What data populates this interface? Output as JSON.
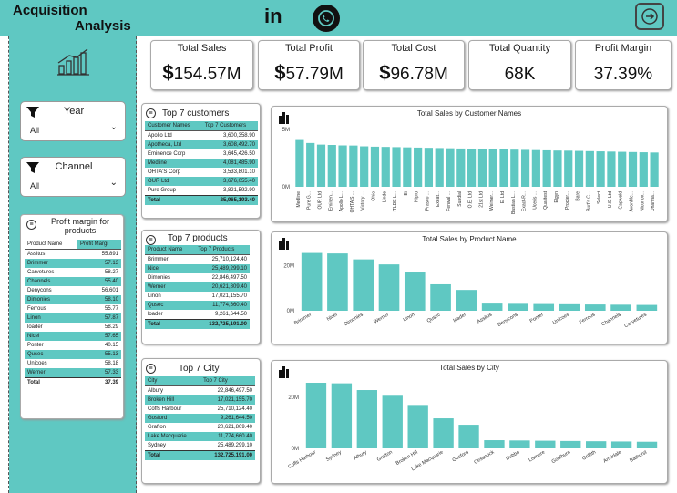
{
  "header": {
    "title_line1": "Acquisition",
    "title_line2": "Analysis",
    "linkedin": "in",
    "whatsapp_icon": "whatsapp-icon",
    "nav_icon": "arrow-right-icon"
  },
  "kpis": [
    {
      "label": "Total Sales",
      "currency": "$",
      "value": "154.57M"
    },
    {
      "label": "Total Profit",
      "currency": "$",
      "value": "57.79M"
    },
    {
      "label": "Total Cost",
      "currency": "$",
      "value": "96.78M"
    },
    {
      "label": "Total Quantity",
      "currency": "",
      "value": "68K"
    },
    {
      "label": "Profit Margin",
      "currency": "",
      "value": "37.39%"
    }
  ],
  "slicers": {
    "year": {
      "title": "Year",
      "value": "All"
    },
    "channel": {
      "title": "Channel",
      "value": "All"
    }
  },
  "profit_margin_table": {
    "title": "Profit margin for products",
    "col1": "Product Name",
    "col2": "Profit Margi",
    "rows": [
      [
        "Assitus",
        "55.891"
      ],
      [
        "Brimmer",
        "57.13"
      ],
      [
        "Carvetures",
        "58.27"
      ],
      [
        "Channels",
        "55.40"
      ],
      [
        "Denycons",
        "56.601"
      ],
      [
        "Dimonies",
        "58.10"
      ],
      [
        "Ferrous",
        "55.77"
      ],
      [
        "Linon",
        "57.87"
      ],
      [
        "loader",
        "58.29"
      ],
      [
        "Nicel",
        "57.65"
      ],
      [
        "Ponter",
        "40.15"
      ],
      [
        "Qusec",
        "55.13"
      ],
      [
        "Unicoes",
        "58.18"
      ],
      [
        "Werner",
        "57.33"
      ]
    ],
    "total": [
      "Total",
      "37.39"
    ]
  },
  "top_customers": {
    "title": "Top 7 customers",
    "col1": "Customer Names",
    "col2": "Top 7 Customers",
    "rows": [
      [
        "Apollo Ltd",
        "3,600,358.90"
      ],
      [
        "Apotheca, Ltd",
        "3,608,492.70"
      ],
      [
        "Eminence Corp",
        "3,645,426.50"
      ],
      [
        "Medline",
        "4,081,485.90"
      ],
      [
        "OHTA'S Corp",
        "3,533,801.10"
      ],
      [
        "OUR Ltd",
        "3,676,055.40"
      ],
      [
        "Pure Group",
        "3,821,592.90"
      ]
    ],
    "total": [
      "Total",
      "25,965,193.40"
    ]
  },
  "top_products": {
    "title": "Top 7 products",
    "col1": "Product Name",
    "col2": "Top 7 Products",
    "rows": [
      [
        "Brimmer",
        "25,710,124.40"
      ],
      [
        "Nicel",
        "25,489,299.10"
      ],
      [
        "Dimonies",
        "22,846,497.50"
      ],
      [
        "Werner",
        "20,621,809.40"
      ],
      [
        "Linon",
        "17,021,155.70"
      ],
      [
        "Qusec",
        "11,774,660.40"
      ],
      [
        "loader",
        "9,261,644.50"
      ]
    ],
    "total": [
      "Total",
      "132,725,191.00"
    ]
  },
  "top_city": {
    "title": "Top 7 City",
    "col1": "City",
    "col2": "Top 7 City",
    "rows": [
      [
        "Albury",
        "22,846,497.50"
      ],
      [
        "Broken Hill",
        "17,021,155.70"
      ],
      [
        "Coffs Harbour",
        "25,710,124.40"
      ],
      [
        "Gosford",
        "9,261,644.50"
      ],
      [
        "Grafton",
        "20,621,809.40"
      ],
      [
        "Lake Macquarie",
        "11,774,660.40"
      ],
      [
        "Sydney",
        "25,489,299.10"
      ]
    ],
    "total": [
      "Total",
      "132,725,191.00"
    ]
  },
  "chart_data": [
    {
      "type": "bar",
      "title": "Total Sales by Customer Names",
      "ylim": [
        0,
        5
      ],
      "yticks": [
        "5M",
        "0M"
      ],
      "categories": [
        "Medline",
        "Pure G...",
        "OUR Ltd",
        "Eminen...",
        "Apollo L...",
        "OHTA'S ...",
        "Victory ...",
        "Ohio",
        "Linde",
        "ITLDE L...",
        "Ei",
        "Nipro",
        "Prasco ...",
        "Exeat...",
        "Fenwal ...",
        "Sundial",
        "O.E. Ltd",
        "21st Ltd",
        "Weimer...",
        "E. Ltd",
        "Bastian L...",
        "Exact-R...",
        "Uceris ...",
        "Qualitest",
        "Elgyn",
        "Procter...",
        "Bare",
        "Burt's C...",
        "Select",
        "U.S. Ltd",
        "Capweld",
        "AvonMe...",
        "Niconov...",
        "Dharma..."
      ],
      "values": [
        4.08,
        3.82,
        3.68,
        3.65,
        3.61,
        3.6,
        3.53,
        3.5,
        3.48,
        3.46,
        3.44,
        3.42,
        3.4,
        3.38,
        3.36,
        3.34,
        3.32,
        3.3,
        3.28,
        3.26,
        3.24,
        3.22,
        3.2,
        3.18,
        3.16,
        3.15,
        3.13,
        3.11,
        3.09,
        3.07,
        3.05,
        3.03,
        3.01,
        2.99
      ]
    },
    {
      "type": "bar",
      "title": "Total Sales by Product Name",
      "ylim": [
        0,
        30
      ],
      "yticks": [
        "20M",
        "0M"
      ],
      "categories": [
        "Brimmer",
        "Nicel",
        "Dimonies",
        "Werner",
        "Linon",
        "Qusec",
        "loader",
        "Assitus",
        "Denycons",
        "Ponter",
        "Unicoes",
        "Ferrous",
        "Channels",
        "Carvetures"
      ],
      "values": [
        25.71,
        25.49,
        22.85,
        20.62,
        17.02,
        11.77,
        9.26,
        3.2,
        3.1,
        3.0,
        2.9,
        2.8,
        2.7,
        2.6
      ]
    },
    {
      "type": "bar",
      "title": "Total Sales by City",
      "ylim": [
        0,
        30
      ],
      "yticks": [
        "20M",
        "0M"
      ],
      "categories": [
        "Coffs Harbour",
        "Sydney",
        "Albury",
        "Grafton",
        "Broken Hill",
        "Lake Macquarie",
        "Gosford",
        "Cessnock",
        "Dubbo",
        "Lismore",
        "Goulburn",
        "Griffith",
        "Armidale",
        "Bathurst"
      ],
      "values": [
        25.71,
        25.49,
        22.85,
        20.62,
        17.02,
        11.77,
        9.26,
        3.2,
        3.1,
        3.0,
        2.9,
        2.8,
        2.7,
        2.6
      ]
    }
  ],
  "colors": {
    "teal": "#5fc8c2",
    "bar": "#5fc8c2"
  }
}
